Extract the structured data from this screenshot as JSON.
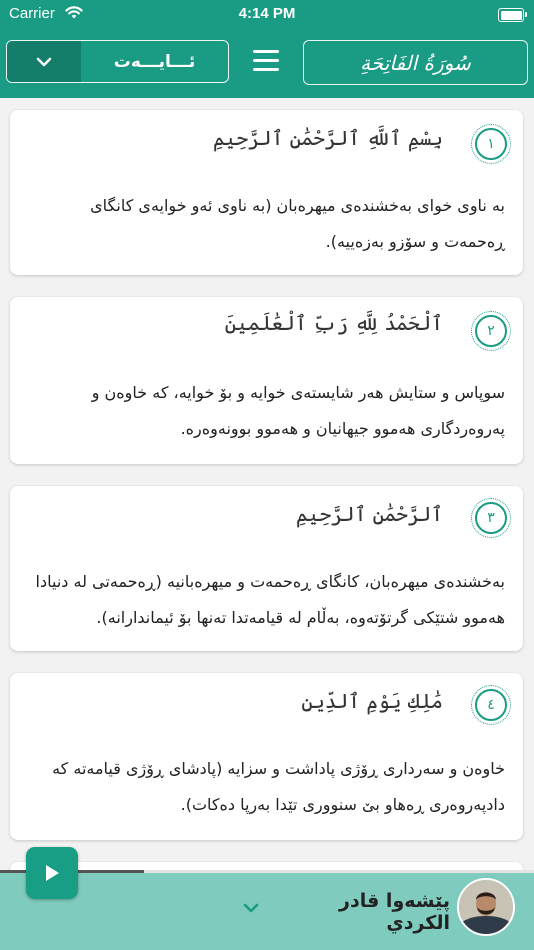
{
  "status_bar": {
    "carrier": "Carrier",
    "time": "4:14 PM"
  },
  "header": {
    "ayah_selector_label": "ئـــايـــەت",
    "surah_title": "سُورَةُ الفَاتِحَةِ"
  },
  "verses": [
    {
      "number": "١",
      "arabic": "بِسْمِ ٱللَّهِ ٱلرَّحْمَٰنِ ٱلرَّحِيمِ",
      "translation": "بە ناوی خوای بەخشندەی میهرەبان (بە ناوی ئەو خوایەی کانگای ڕەحمەت و سۆزو بەزەییە)."
    },
    {
      "number": "٢",
      "arabic": "ٱلْحَمْدُ لِلَّهِ رَبِّ ٱلْعَٰلَمِينَ",
      "translation": "سوپاس و ستایش هەر شایستەی خوایە و بۆ خوایە، کە خاوەن و پەروەردگاری هەموو جیهانیان و هەموو بوونەوەرە."
    },
    {
      "number": "٣",
      "arabic": "ٱلرَّحْمَٰنِ ٱلرَّحِيمِ",
      "translation": "بەخشندەی میهرەبان، کانگای ڕەحمەت و میهرەبانیە (ڕەحمەتی لە دنیادا هەموو شتێکی گرتۆتەوە، بەڵام لە قیامەتدا تەنها بۆ ئیماندارانە)."
    },
    {
      "number": "٤",
      "arabic": "مَٰلِكِ يَوْمِ ٱلدِّينِ",
      "translation": "خاوەن و سەرداری ڕۆژی پاداشت و سزایە (پادشای ڕۆژی قیامەتە کە دادپەروەری ڕەهاو بێ سنووری تێدا بەرپا دەکات)."
    }
  ],
  "player": {
    "reciter_name": "پێشەوا قادر الكردي",
    "progress": 0.27
  },
  "colors": {
    "primary": "#1a9b83",
    "primary_dark": "#157e6b",
    "player_bg": "#7fcbbd"
  },
  "icons": [
    "wifi-icon",
    "battery-icon",
    "chevron-down-icon",
    "menu-icon",
    "play-icon",
    "avatar"
  ]
}
